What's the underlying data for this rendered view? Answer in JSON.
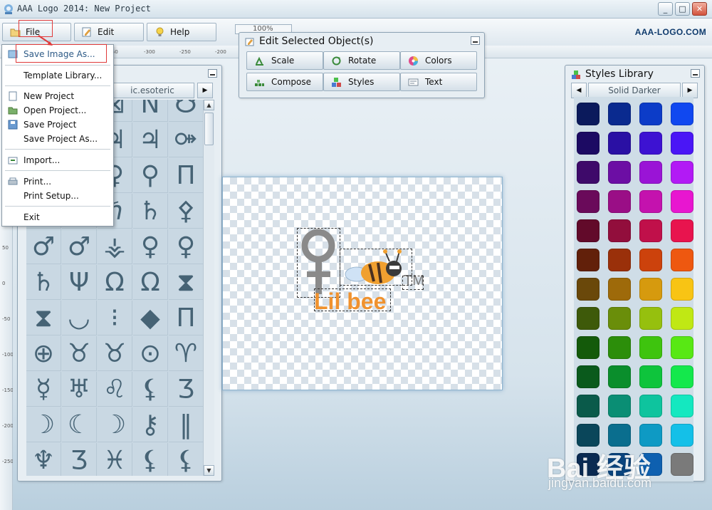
{
  "window": {
    "title": "AAA Logo 2014: New Project",
    "min_label": "_",
    "max_label": "□",
    "close_label": "✕"
  },
  "toolbar": {
    "file_label": "File",
    "edit_label": "Edit",
    "help_label": "Help",
    "zoom_value": "100%",
    "brand": "AAA-LOGO.COM"
  },
  "ruler": {
    "top_ticks": [
      "-350",
      "-300",
      "-250",
      "-200"
    ],
    "left_ticks": [
      "50",
      "0",
      "-50",
      "-100",
      "-150",
      "-200",
      "-250"
    ]
  },
  "edit_panel": {
    "title": "Edit Selected Object(s)",
    "buttons": [
      "Scale",
      "Rotate",
      "Colors",
      "Compose",
      "Styles",
      "Text"
    ]
  },
  "symbol_panel": {
    "library_name": "Symbols.esoteric",
    "library_visible_text": "ic.esoteric",
    "symbols": [
      "♃",
      "☽",
      "⊠",
      "N",
      "☋",
      "♄",
      "⚸",
      "♃",
      "♃",
      "⚩",
      "♅",
      "♆",
      "♀",
      "⚲",
      "Π",
      "♇",
      "♄",
      "ℏ",
      "♄",
      "⚴",
      "♂",
      "♂",
      "⚶",
      "♀",
      "♀",
      "♄",
      "Ψ",
      "Ω",
      "Ω",
      "⧗",
      "⧗",
      "◡",
      "⁝",
      "◆",
      "Π",
      "⊕",
      "♉",
      "♉",
      "⊙",
      "♈",
      "☿",
      "♅",
      "♌",
      "⚸",
      "Ʒ",
      "☽",
      "☾",
      "☽",
      "⚷",
      "‖",
      "♆",
      "Ʒ",
      "♓",
      "⚸",
      "⚸"
    ]
  },
  "styles_panel": {
    "title": "Styles Library",
    "preset": "Solid Darker",
    "colors": [
      "#0b1a5c",
      "#0a2a8f",
      "#0c3cc8",
      "#1048f0",
      "#1c0a63",
      "#2a10a4",
      "#3d12d2",
      "#4a16f6",
      "#3e0a6a",
      "#6c0ea4",
      "#9a14d6",
      "#b21af5",
      "#6a0a5a",
      "#9a0e86",
      "#c412ae",
      "#e816d0",
      "#620a2a",
      "#920e3c",
      "#c0104a",
      "#e8144e",
      "#62200a",
      "#9a300a",
      "#cc420c",
      "#ee5810",
      "#6a480a",
      "#9e6a0a",
      "#d69a0e",
      "#f8c414",
      "#3e5a0a",
      "#6a8e0a",
      "#96c00e",
      "#c0e814",
      "#145a0a",
      "#2c8e0a",
      "#3ec40e",
      "#58e814",
      "#0a5a1c",
      "#0a8e2c",
      "#0ec43c",
      "#14e84c",
      "#0a5a4a",
      "#0a8e74",
      "#0ec49e",
      "#14e8c0",
      "#0a465a",
      "#0a6e8e",
      "#0e9ac4",
      "#14c0e8",
      "#0a2a52",
      "#0a447e",
      "#0e60b0",
      "#7a7a7a"
    ]
  },
  "canvas": {
    "logo_text": "Lil bee",
    "tm_text": "TM"
  },
  "file_menu": {
    "items": [
      "Save Image As...",
      "Template Library...",
      "New Project",
      "Open Project...",
      "Save Project",
      "Save Project As...",
      "Import...",
      "Print...",
      "Print Setup...",
      "Exit"
    ]
  },
  "watermark": {
    "main": "Bai 经验",
    "sub": "jingyan.baidu.com"
  }
}
